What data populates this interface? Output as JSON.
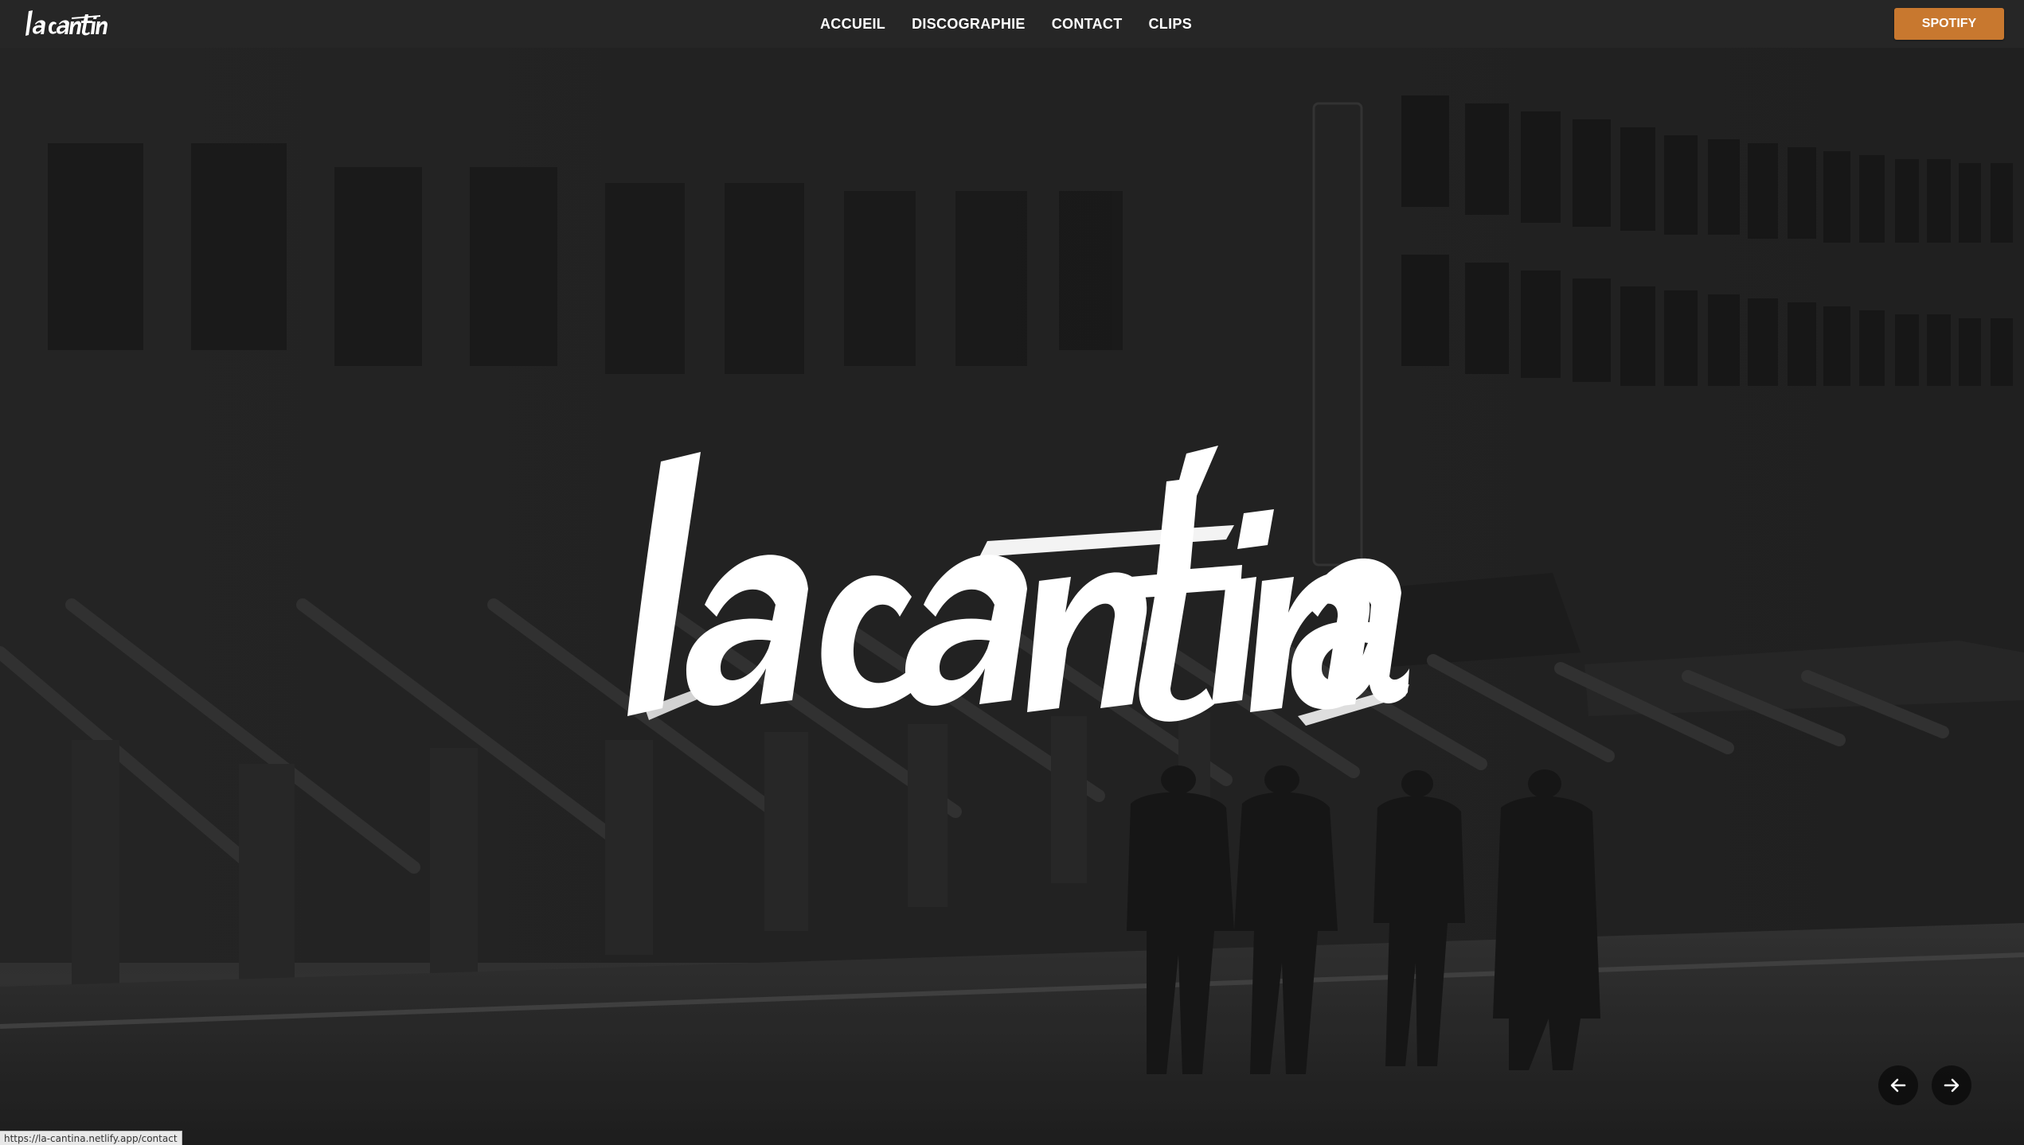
{
  "brand": {
    "name": "la cantina",
    "logo_icon": "la-cantina-script-logo"
  },
  "nav": {
    "items": [
      {
        "label": "ACCUEIL"
      },
      {
        "label": "DISCOGRAPHIE"
      },
      {
        "label": "CONTACT"
      },
      {
        "label": "CLIPS"
      }
    ]
  },
  "header": {
    "spotify_label": "SPOTIFY",
    "accent_color": "#c8782f"
  },
  "hero": {
    "title": "la cantina",
    "background": "black-and-white street photo of brownstone stairs and four men walking",
    "prev_icon": "arrow-left-icon",
    "next_icon": "arrow-right-icon"
  },
  "status_bar": {
    "url": "https://la-cantina.netlify.app/contact"
  }
}
